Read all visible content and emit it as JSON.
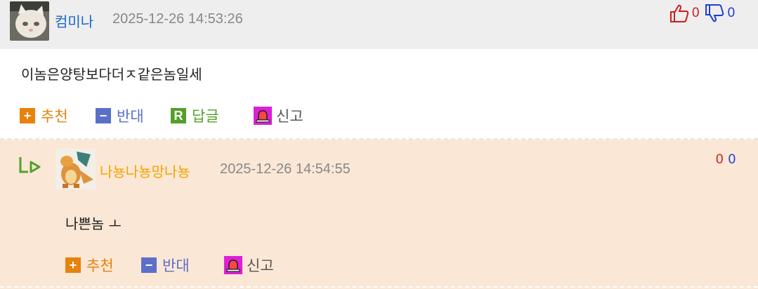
{
  "comment1": {
    "author": "컴미나",
    "timestamp": "2025-12-26 14:53:26",
    "upvotes": "0",
    "downvotes": "0",
    "text": "이놈은양탕보다더ㅈ같은놈일세",
    "actions": {
      "recommend": "추천",
      "oppose": "반대",
      "reply": "답글",
      "report": "신고"
    }
  },
  "reply1": {
    "author": "나뇽나뇽망나뇽",
    "timestamp": "2025-12-26 14:54:55",
    "upvotes": "0",
    "downvotes": "0",
    "text": "나쁜놈 ㅗ",
    "actions": {
      "recommend": "추천",
      "oppose": "반대",
      "report": "신고"
    }
  },
  "icons": {
    "recommend_box": "+",
    "oppose_box": "−",
    "reply_box": "R"
  },
  "colors": {
    "author_blue": "#1a66c9",
    "author_orange": "#f0a400",
    "recommend": "#e8820c",
    "oppose": "#5a6fc8",
    "reply": "#52a02a",
    "report": "#dd1fd6",
    "up": "#d21b1b",
    "down": "#1c3fd6"
  }
}
